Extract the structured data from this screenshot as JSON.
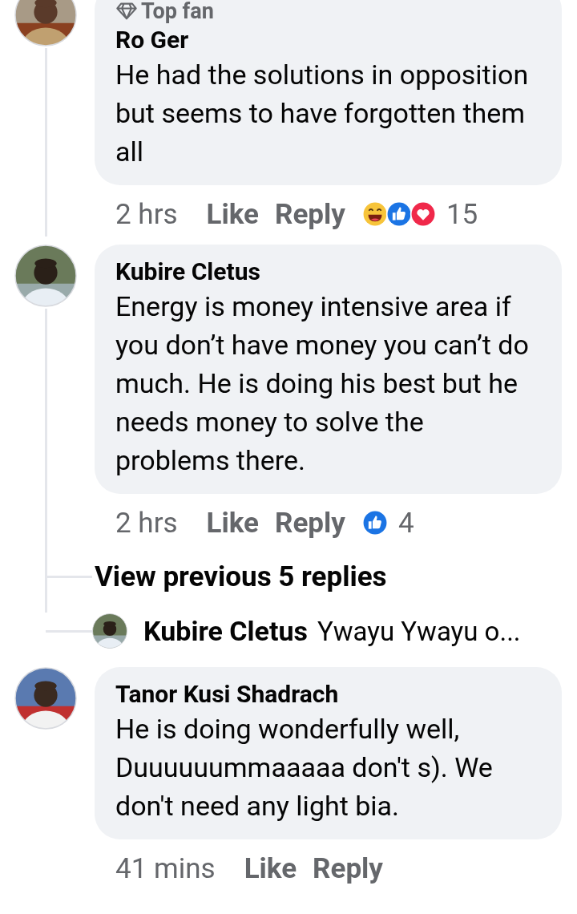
{
  "comments": [
    {
      "badge": "Top fan",
      "author": "Ro Ger",
      "text": "He had the solutions in opposition but seems to have forgotten them all",
      "time": "2 hrs",
      "like": "Like",
      "reply": "Reply",
      "reactions": [
        {
          "kind": "haha"
        },
        {
          "kind": "like"
        },
        {
          "kind": "love"
        }
      ],
      "reaction_count": "15",
      "thread": true
    },
    {
      "author": "Kubire Cletus",
      "text": "Energy is money intensive area if you don’t have money you can’t do much. He is doing his best but he needs money to solve the problems there.",
      "time": "2 hrs",
      "like": "Like",
      "reply": "Reply",
      "reactions": [
        {
          "kind": "like"
        }
      ],
      "reaction_count": "4",
      "thread": true,
      "replies": {
        "view_more": "View previous 5 replies",
        "latest": {
          "author": "Kubire Cletus",
          "text": "Ywayu Ywayu o..."
        }
      }
    },
    {
      "author": "Tanor Kusi Shadrach",
      "text": "He is doing wonderfully well, Duuuuuummaaaaa don't s). We don't need any light bia.",
      "time": "41 mins",
      "like": "Like",
      "reply": "Reply",
      "thread": false
    }
  ]
}
